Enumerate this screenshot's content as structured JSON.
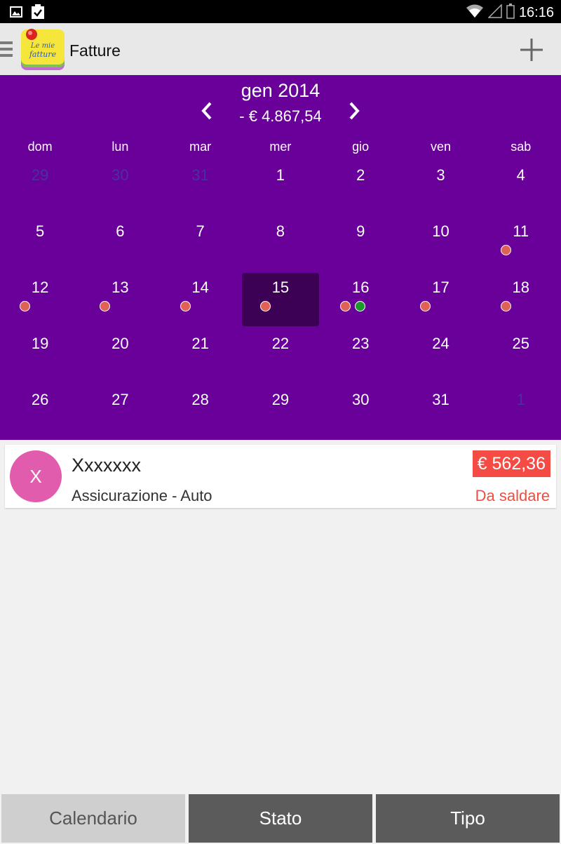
{
  "status_bar": {
    "time": "16:16",
    "icons": [
      "image-icon",
      "clipboard-check-icon",
      "wifi-icon",
      "signal-icon",
      "battery-icon"
    ]
  },
  "action_bar": {
    "logo_text": "Le mie fatture",
    "title": "Fatture",
    "add_icon": "plus-icon",
    "menu_icon": "hamburger-icon"
  },
  "calendar": {
    "month_title": "gen 2014",
    "month_total": "- € 4.867,54",
    "weekdays": [
      "dom",
      "lun",
      "mar",
      "mer",
      "gio",
      "ven",
      "sab"
    ],
    "weeks": [
      [
        {
          "num": "29",
          "other": true,
          "dots": []
        },
        {
          "num": "30",
          "other": true,
          "dots": []
        },
        {
          "num": "31",
          "other": true,
          "dots": []
        },
        {
          "num": "1",
          "other": false,
          "dots": []
        },
        {
          "num": "2",
          "other": false,
          "dots": []
        },
        {
          "num": "3",
          "other": false,
          "dots": []
        },
        {
          "num": "4",
          "other": false,
          "dots": []
        }
      ],
      [
        {
          "num": "5",
          "other": false,
          "dots": []
        },
        {
          "num": "6",
          "other": false,
          "dots": []
        },
        {
          "num": "7",
          "other": false,
          "dots": []
        },
        {
          "num": "8",
          "other": false,
          "dots": []
        },
        {
          "num": "9",
          "other": false,
          "dots": []
        },
        {
          "num": "10",
          "other": false,
          "dots": []
        },
        {
          "num": "11",
          "other": false,
          "dots": [
            "red"
          ]
        }
      ],
      [
        {
          "num": "12",
          "other": false,
          "dots": [
            "red"
          ]
        },
        {
          "num": "13",
          "other": false,
          "dots": [
            "red"
          ]
        },
        {
          "num": "14",
          "other": false,
          "dots": [
            "red"
          ]
        },
        {
          "num": "15",
          "other": false,
          "selected": true,
          "dots": [
            "red"
          ]
        },
        {
          "num": "16",
          "other": false,
          "dots": [
            "red",
            "green"
          ]
        },
        {
          "num": "17",
          "other": false,
          "dots": [
            "red"
          ]
        },
        {
          "num": "18",
          "other": false,
          "dots": [
            "red"
          ]
        }
      ],
      [
        {
          "num": "19",
          "other": false,
          "dots": []
        },
        {
          "num": "20",
          "other": false,
          "dots": []
        },
        {
          "num": "21",
          "other": false,
          "dots": []
        },
        {
          "num": "22",
          "other": false,
          "dots": []
        },
        {
          "num": "23",
          "other": false,
          "dots": []
        },
        {
          "num": "24",
          "other": false,
          "dots": []
        },
        {
          "num": "25",
          "other": false,
          "dots": []
        }
      ],
      [
        {
          "num": "26",
          "other": false,
          "dots": []
        },
        {
          "num": "27",
          "other": false,
          "dots": []
        },
        {
          "num": "28",
          "other": false,
          "dots": []
        },
        {
          "num": "29",
          "other": false,
          "dots": []
        },
        {
          "num": "30",
          "other": false,
          "dots": []
        },
        {
          "num": "31",
          "other": false,
          "dots": []
        },
        {
          "num": "1",
          "other": true,
          "dots": []
        }
      ]
    ]
  },
  "invoice": {
    "avatar_letter": "X",
    "name": "Xxxxxxx",
    "category": "Assicurazione - Auto",
    "amount": "€ 562,36",
    "status": "Da saldare"
  },
  "tabs": [
    {
      "label": "Calendario",
      "active": true
    },
    {
      "label": "Stato",
      "active": false
    },
    {
      "label": "Tipo",
      "active": false
    }
  ],
  "colors": {
    "calendar_bg": "#690099",
    "selected_day_bg": "#3c0055",
    "dot_red": "#e06155",
    "dot_green": "#1c9a2c",
    "avatar_bg": "#e25cae",
    "amount_badge_bg": "#f44c44",
    "status_text": "#f24d40"
  }
}
